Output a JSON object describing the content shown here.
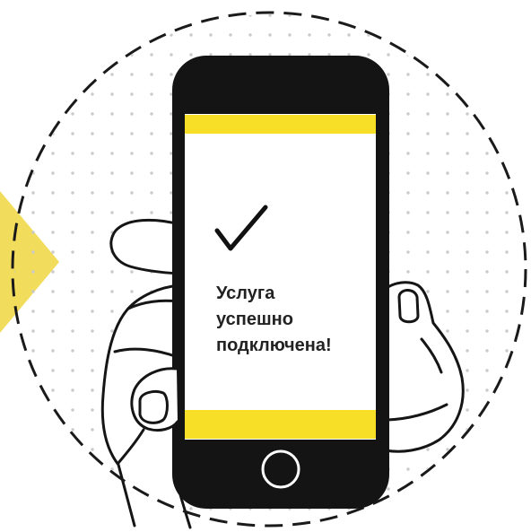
{
  "illustration": {
    "screen": {
      "status_icon": "checkmark-icon",
      "message_lines": [
        "Услуга",
        "успешно",
        "подключена!"
      ]
    },
    "phone": {
      "home_button_icon": "home-button-icon"
    }
  },
  "colors": {
    "accent_yellow": "#f8df27",
    "triangle_yellow": "#f2dc5c",
    "phone_body": "#141414",
    "screen": "#ffffff",
    "dots": "#c9c9c9"
  }
}
